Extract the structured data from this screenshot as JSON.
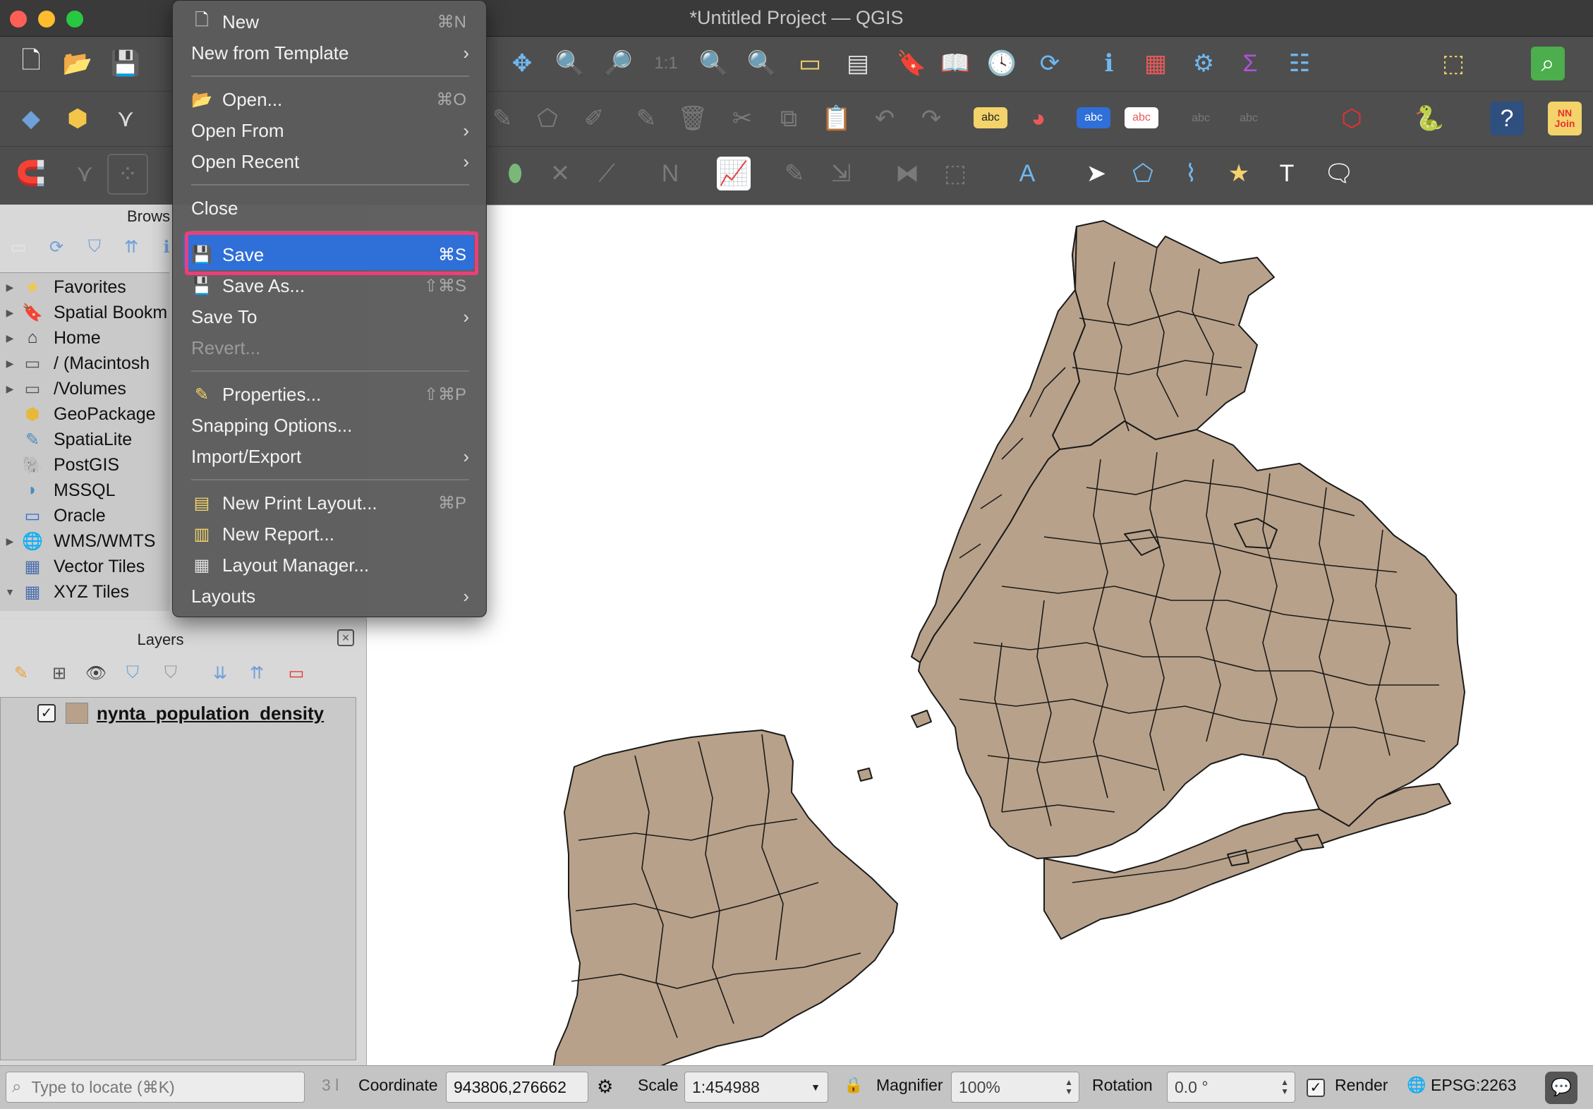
{
  "window": {
    "title": "*Untitled Project — QGIS"
  },
  "file_menu": {
    "items": {
      "new": {
        "label": "New",
        "shortcut": "⌘N"
      },
      "new_from_template": {
        "label": "New from Template"
      },
      "open": {
        "label": "Open...",
        "shortcut": "⌘O"
      },
      "open_from": {
        "label": "Open From"
      },
      "open_recent": {
        "label": "Open Recent"
      },
      "close": {
        "label": "Close"
      },
      "save": {
        "label": "Save",
        "shortcut": "⌘S"
      },
      "save_as": {
        "label": "Save As...",
        "shortcut": "⇧⌘S"
      },
      "save_to": {
        "label": "Save To"
      },
      "revert": {
        "label": "Revert..."
      },
      "properties": {
        "label": "Properties...",
        "shortcut": "⇧⌘P"
      },
      "snapping": {
        "label": "Snapping Options..."
      },
      "import_export": {
        "label": "Import/Export"
      },
      "new_print_layout": {
        "label": "New Print Layout...",
        "shortcut": "⌘P"
      },
      "new_report": {
        "label": "New Report..."
      },
      "layout_manager": {
        "label": "Layout Manager..."
      },
      "layouts": {
        "label": "Layouts"
      }
    }
  },
  "browser": {
    "title": "Brows",
    "items": [
      {
        "label": "Favorites",
        "icon": "star-icon"
      },
      {
        "label": "Spatial Bookm",
        "icon": "bookmark-icon"
      },
      {
        "label": "Home",
        "icon": "home-icon"
      },
      {
        "label": "/ (Macintosh",
        "icon": "folder-icon"
      },
      {
        "label": "/Volumes",
        "icon": "folder-icon"
      },
      {
        "label": "GeoPackage",
        "icon": "geopackage-icon"
      },
      {
        "label": "SpatiaLite",
        "icon": "spatialite-icon"
      },
      {
        "label": "PostGIS",
        "icon": "postgis-icon"
      },
      {
        "label": "MSSQL",
        "icon": "mssql-icon"
      },
      {
        "label": "Oracle",
        "icon": "oracle-icon"
      },
      {
        "label": "WMS/WMTS",
        "icon": "globe-icon"
      },
      {
        "label": "Vector Tiles",
        "icon": "grid-icon"
      },
      {
        "label": "XYZ Tiles",
        "icon": "grid-icon"
      }
    ]
  },
  "layers": {
    "title": "Layers",
    "layer_name": "nynta_population_density",
    "layer_color": "#b8a18a"
  },
  "statusbar": {
    "locate_placeholder": "Type to locate (⌘K)",
    "messages_count": "3 l",
    "coordinate_label": "Coordinate",
    "coordinate_value": "943806,276662",
    "scale_label": "Scale",
    "scale_value": "1:454988",
    "magnifier_label": "Magnifier",
    "magnifier_value": "100%",
    "rotation_label": "Rotation",
    "rotation_value": "0.0 °",
    "render_label": "Render",
    "crs": "EPSG:2263"
  },
  "toolbar_glyphs": {
    "nn_join": "NN Join",
    "abc": "abc"
  },
  "colors": {
    "accent": "#2f6fd8",
    "highlight_outline": "#ec3e78",
    "map_fill": "#b8a18a"
  }
}
